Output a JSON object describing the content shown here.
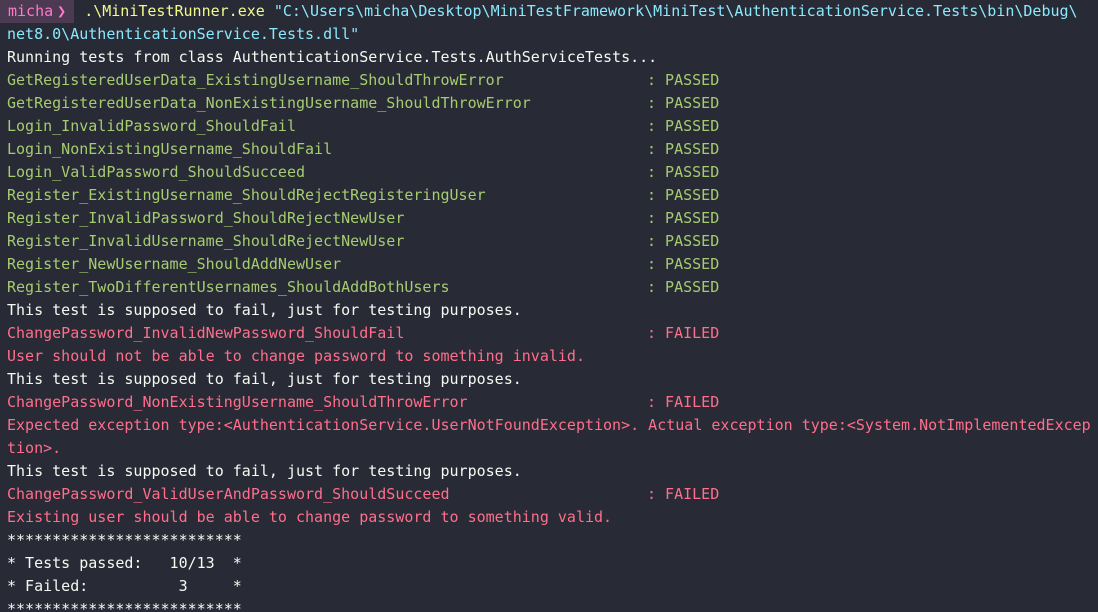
{
  "prompt": {
    "user": "micha",
    "chevron": "❯",
    "command": ".\\MiniTestRunner.exe",
    "argument_part1": "\"C:\\Users\\micha\\Desktop\\MiniTestFramework\\MiniTest\\AuthenticationService.Tests\\bin\\Debug\\",
    "argument_part2": "net8.0\\AuthenticationService.Tests.dll\""
  },
  "header": "Running tests from class AuthenticationService.Tests.AuthServiceTests...",
  "results": [
    {
      "name": "GetRegisteredUserData_ExistingUsername_ShouldThrowError",
      "status": ": PASSED"
    },
    {
      "name": "GetRegisteredUserData_NonExistingUsername_ShouldThrowError",
      "status": ": PASSED"
    },
    {
      "name": "Login_InvalidPassword_ShouldFail",
      "status": ": PASSED"
    },
    {
      "name": "Login_NonExistingUsername_ShouldFail",
      "status": ": PASSED"
    },
    {
      "name": "Login_ValidPassword_ShouldSucceed",
      "status": ": PASSED"
    },
    {
      "name": "Register_ExistingUsername_ShouldRejectRegisteringUser",
      "status": ": PASSED"
    },
    {
      "name": "Register_InvalidPassword_ShouldRejectNewUser",
      "status": ": PASSED"
    },
    {
      "name": "Register_InvalidUsername_ShouldRejectNewUser",
      "status": ": PASSED"
    },
    {
      "name": "Register_NewUsername_ShouldAddNewUser",
      "status": ": PASSED"
    },
    {
      "name": "Register_TwoDifferentUsernames_ShouldAddBothUsers",
      "status": ": PASSED"
    }
  ],
  "failures": [
    {
      "note": "This test is supposed to fail, just for testing purposes.",
      "name": "ChangePassword_InvalidNewPassword_ShouldFail",
      "status": ": FAILED",
      "message_lines": [
        "User should not be able to change password to something invalid."
      ]
    },
    {
      "note": "This test is supposed to fail, just for testing purposes.",
      "name": "ChangePassword_NonExistingUsername_ShouldThrowError",
      "status": ": FAILED",
      "message_lines": [
        "Expected exception type:<AuthenticationService.UserNotFoundException>. Actual exception type:<System.NotImplementedExcep",
        "tion>."
      ]
    },
    {
      "note": "This test is supposed to fail, just for testing purposes.",
      "name": "ChangePassword_ValidUserAndPassword_ShouldSucceed",
      "status": ": FAILED",
      "message_lines": [
        "Existing user should be able to change password to something valid."
      ]
    }
  ],
  "summary": {
    "border_top": "**************************",
    "passed_line": "* Tests passed:   10/13  *",
    "failed_line": "* Failed:          3     *",
    "border_bottom": "**************************"
  },
  "colors": {
    "background": "#282a36",
    "passed": "#a6cc70",
    "failed": "#ff6e8a",
    "command": "#f1fa8c",
    "path": "#8be9fd",
    "prompt": "#ff79c6"
  }
}
